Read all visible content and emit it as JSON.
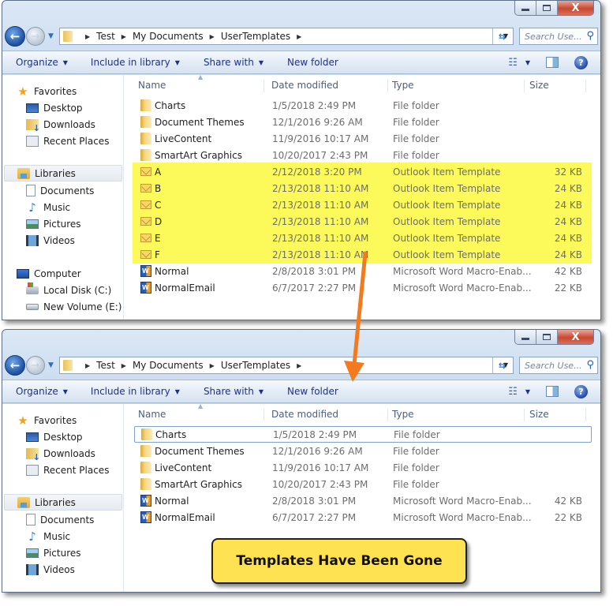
{
  "windows": [
    {
      "id": "before",
      "caption": {
        "minimize": "—",
        "maximize": "□",
        "close": "X"
      },
      "nav": {
        "back_icon": "back-arrow-icon",
        "forward_icon": "forward-arrow-icon"
      },
      "breadcrumb": [
        "Test",
        "My Documents",
        "UserTemplates"
      ],
      "search_placeholder": "Search Use...",
      "toolbar": [
        "Organize",
        "Include in library",
        "Share with",
        "New folder"
      ],
      "nav_pane": {
        "favorites": {
          "label": "Favorites",
          "items": [
            "Desktop",
            "Downloads",
            "Recent Places"
          ]
        },
        "libraries": {
          "label": "Libraries",
          "items": [
            "Documents",
            "Music",
            "Pictures",
            "Videos"
          ]
        },
        "computer": {
          "label": "Computer",
          "items": [
            "Local Disk (C:)",
            "New Volume (E:)"
          ]
        }
      },
      "columns": [
        "Name",
        "Date modified",
        "Type",
        "Size"
      ],
      "files": [
        {
          "name": "Charts",
          "date": "1/5/2018 2:49 PM",
          "type": "File folder",
          "size": "",
          "icon": "folder",
          "highlight": false
        },
        {
          "name": "Document Themes",
          "date": "12/1/2016 9:26 AM",
          "type": "File folder",
          "size": "",
          "icon": "folder",
          "highlight": false
        },
        {
          "name": "LiveContent",
          "date": "11/9/2016 10:17 AM",
          "type": "File folder",
          "size": "",
          "icon": "folder",
          "highlight": false
        },
        {
          "name": "SmartArt Graphics",
          "date": "10/20/2017 2:43 PM",
          "type": "File folder",
          "size": "",
          "icon": "folder",
          "highlight": false
        },
        {
          "name": "A",
          "date": "2/12/2018 3:20 PM",
          "type": "Outlook Item Template",
          "size": "32 KB",
          "icon": "mail",
          "highlight": true
        },
        {
          "name": "B",
          "date": "2/13/2018 11:10 AM",
          "type": "Outlook Item Template",
          "size": "24 KB",
          "icon": "mail",
          "highlight": true
        },
        {
          "name": "C",
          "date": "2/13/2018 11:10 AM",
          "type": "Outlook Item Template",
          "size": "24 KB",
          "icon": "mail",
          "highlight": true
        },
        {
          "name": "D",
          "date": "2/13/2018 11:10 AM",
          "type": "Outlook Item Template",
          "size": "24 KB",
          "icon": "mail",
          "highlight": true
        },
        {
          "name": "E",
          "date": "2/13/2018 11:10 AM",
          "type": "Outlook Item Template",
          "size": "24 KB",
          "icon": "mail",
          "highlight": true
        },
        {
          "name": "F",
          "date": "2/13/2018 11:10 AM",
          "type": "Outlook Item Template",
          "size": "24 KB",
          "icon": "mail",
          "highlight": true
        },
        {
          "name": "Normal",
          "date": "2/8/2018 3:01 PM",
          "type": "Microsoft Word Macro-Enab...",
          "size": "42 KB",
          "icon": "word",
          "highlight": false
        },
        {
          "name": "NormalEmail",
          "date": "6/7/2017 2:27 PM",
          "type": "Microsoft Word Macro-Enab...",
          "size": "22 KB",
          "icon": "word",
          "highlight": false
        }
      ]
    },
    {
      "id": "after",
      "caption": {
        "minimize": "—",
        "maximize": "□",
        "close": "X"
      },
      "nav": {
        "back_icon": "back-arrow-icon",
        "forward_icon": "forward-arrow-icon"
      },
      "breadcrumb": [
        "Test",
        "My Documents",
        "UserTemplates"
      ],
      "search_placeholder": "Search Use...",
      "toolbar": [
        "Organize",
        "Include in library",
        "Share with",
        "New folder"
      ],
      "nav_pane": {
        "favorites": {
          "label": "Favorites",
          "items": [
            "Desktop",
            "Downloads",
            "Recent Places"
          ]
        },
        "libraries": {
          "label": "Libraries",
          "items": [
            "Documents",
            "Music",
            "Pictures",
            "Videos"
          ]
        },
        "computer": null
      },
      "columns": [
        "Name",
        "Date modified",
        "Type",
        "Size"
      ],
      "files": [
        {
          "name": "Charts",
          "date": "1/5/2018 2:49 PM",
          "type": "File folder",
          "size": "",
          "icon": "folder",
          "highlight": false,
          "focused": true
        },
        {
          "name": "Document Themes",
          "date": "12/1/2016 9:26 AM",
          "type": "File folder",
          "size": "",
          "icon": "folder",
          "highlight": false
        },
        {
          "name": "LiveContent",
          "date": "11/9/2016 10:17 AM",
          "type": "File folder",
          "size": "",
          "icon": "folder",
          "highlight": false
        },
        {
          "name": "SmartArt Graphics",
          "date": "10/20/2017 2:43 PM",
          "type": "File folder",
          "size": "",
          "icon": "folder",
          "highlight": false
        },
        {
          "name": "Normal",
          "date": "2/8/2018 3:01 PM",
          "type": "Microsoft Word Macro-Enab...",
          "size": "42 KB",
          "icon": "word",
          "highlight": false
        },
        {
          "name": "NormalEmail",
          "date": "6/7/2017 2:27 PM",
          "type": "Microsoft Word Macro-Enab...",
          "size": "22 KB",
          "icon": "word",
          "highlight": false
        }
      ]
    }
  ],
  "annotation": {
    "callout_text": "Templates Have Been Gone",
    "callout_color": "#fee251",
    "highlight_color": "#fcfa5a",
    "arrow_color": "#f47a1f"
  }
}
